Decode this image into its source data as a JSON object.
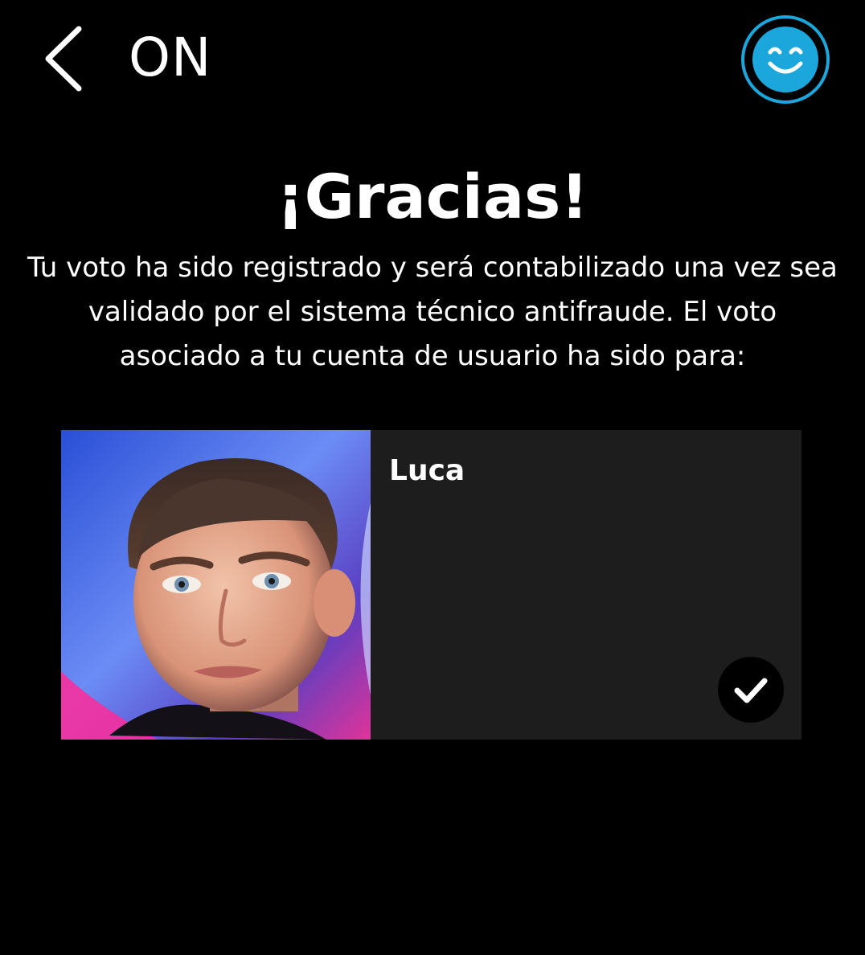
{
  "header": {
    "back_icon": "chevron-left-icon",
    "title": "ON",
    "profile_icon": "smiley-face-icon",
    "accent_color": "#1ba6dc"
  },
  "confirmation": {
    "title": "¡Gracias!",
    "message": "Tu voto ha sido registrado y será contabilizado una vez sea validado por el sistema técnico antifraude. El voto asociado a tu cuenta de usuario ha sido para:"
  },
  "vote": {
    "candidate_name": "Luca",
    "selected_icon": "checkmark-icon",
    "card_color": "#1d1d1d"
  }
}
